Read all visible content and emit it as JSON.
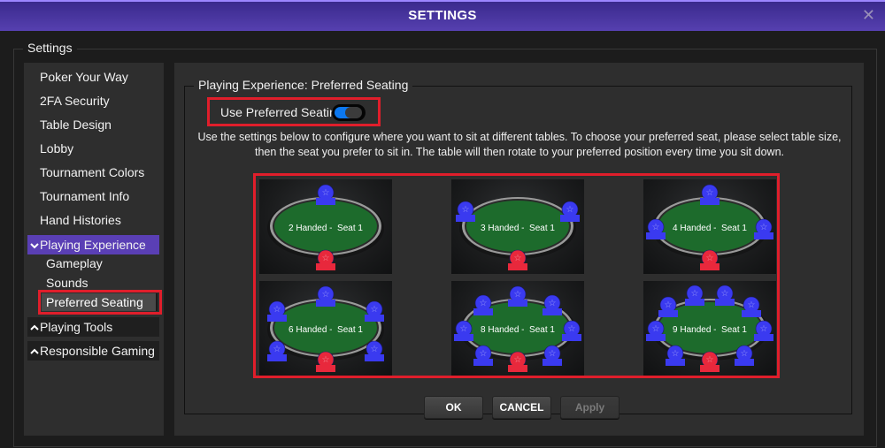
{
  "window": {
    "title": "SETTINGS",
    "close_icon": "close-x-icon"
  },
  "outer_legend": "Settings",
  "sidebar": {
    "items": [
      {
        "label": "Poker Your Way"
      },
      {
        "label": "2FA Security"
      },
      {
        "label": "Table Design"
      },
      {
        "label": "Lobby"
      },
      {
        "label": "Tournament Colors"
      },
      {
        "label": "Tournament Info"
      },
      {
        "label": "Hand Histories"
      }
    ],
    "groups": [
      {
        "label": "Playing Experience",
        "state": "expanded",
        "icon": "chevron-down-icon",
        "children": [
          {
            "label": "Gameplay"
          },
          {
            "label": "Sounds"
          },
          {
            "label": "Preferred Seating",
            "selected": true
          }
        ]
      },
      {
        "label": "Playing Tools",
        "state": "collapsed",
        "icon": "chevron-up-icon"
      },
      {
        "label": "Responsible Gaming",
        "state": "collapsed",
        "icon": "chevron-up-icon"
      }
    ],
    "chev_down": "⌄",
    "chev_up": "^"
  },
  "panel": {
    "legend": "Playing Experience: Preferred Seating",
    "toggle": {
      "label": "Use Preferred Seating",
      "on": true,
      "color": "#0c78f0"
    },
    "description": "Use the settings below to configure where you want to sit at different tables. To choose your preferred seat, please select table size, then the seat you prefer to sit in. The table will then rotate to your preferred position every time you sit down.",
    "tables": [
      {
        "label": "2 Handed -  Seat 1",
        "players": 2,
        "preferred_seat": 1
      },
      {
        "label": "3 Handed -  Seat 1",
        "players": 3,
        "preferred_seat": 1
      },
      {
        "label": "4 Handed -  Seat 1",
        "players": 4,
        "preferred_seat": 1
      },
      {
        "label": "6 Handed -  Seat 1",
        "players": 6,
        "preferred_seat": 1
      },
      {
        "label": "8 Handed -  Seat 1",
        "players": 8,
        "preferred_seat": 1
      },
      {
        "label": "9 Handed -  Seat 1",
        "players": 9,
        "preferred_seat": 1
      }
    ],
    "colors": {
      "seat_other": "#3a3af0",
      "seat_preferred": "#e8283c",
      "felt": "#1d6b2c",
      "highlight": "#e01e2b"
    }
  },
  "buttons": {
    "ok": "OK",
    "cancel": "CANCEL",
    "apply": "Apply",
    "apply_disabled": true
  }
}
